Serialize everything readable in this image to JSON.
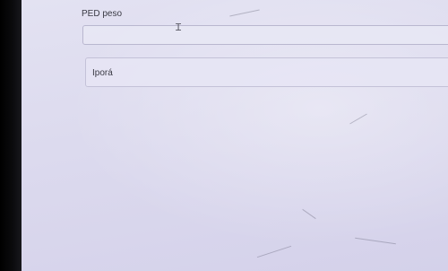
{
  "form": {
    "field_label": "PED peso",
    "field_value": "",
    "select_value": "Iporá"
  },
  "colors": {
    "page_background": "#dcdaee",
    "text": "#3a3a44",
    "border": "#b9b7cf"
  },
  "icons": {
    "cursor": "text-cursor-icon"
  }
}
